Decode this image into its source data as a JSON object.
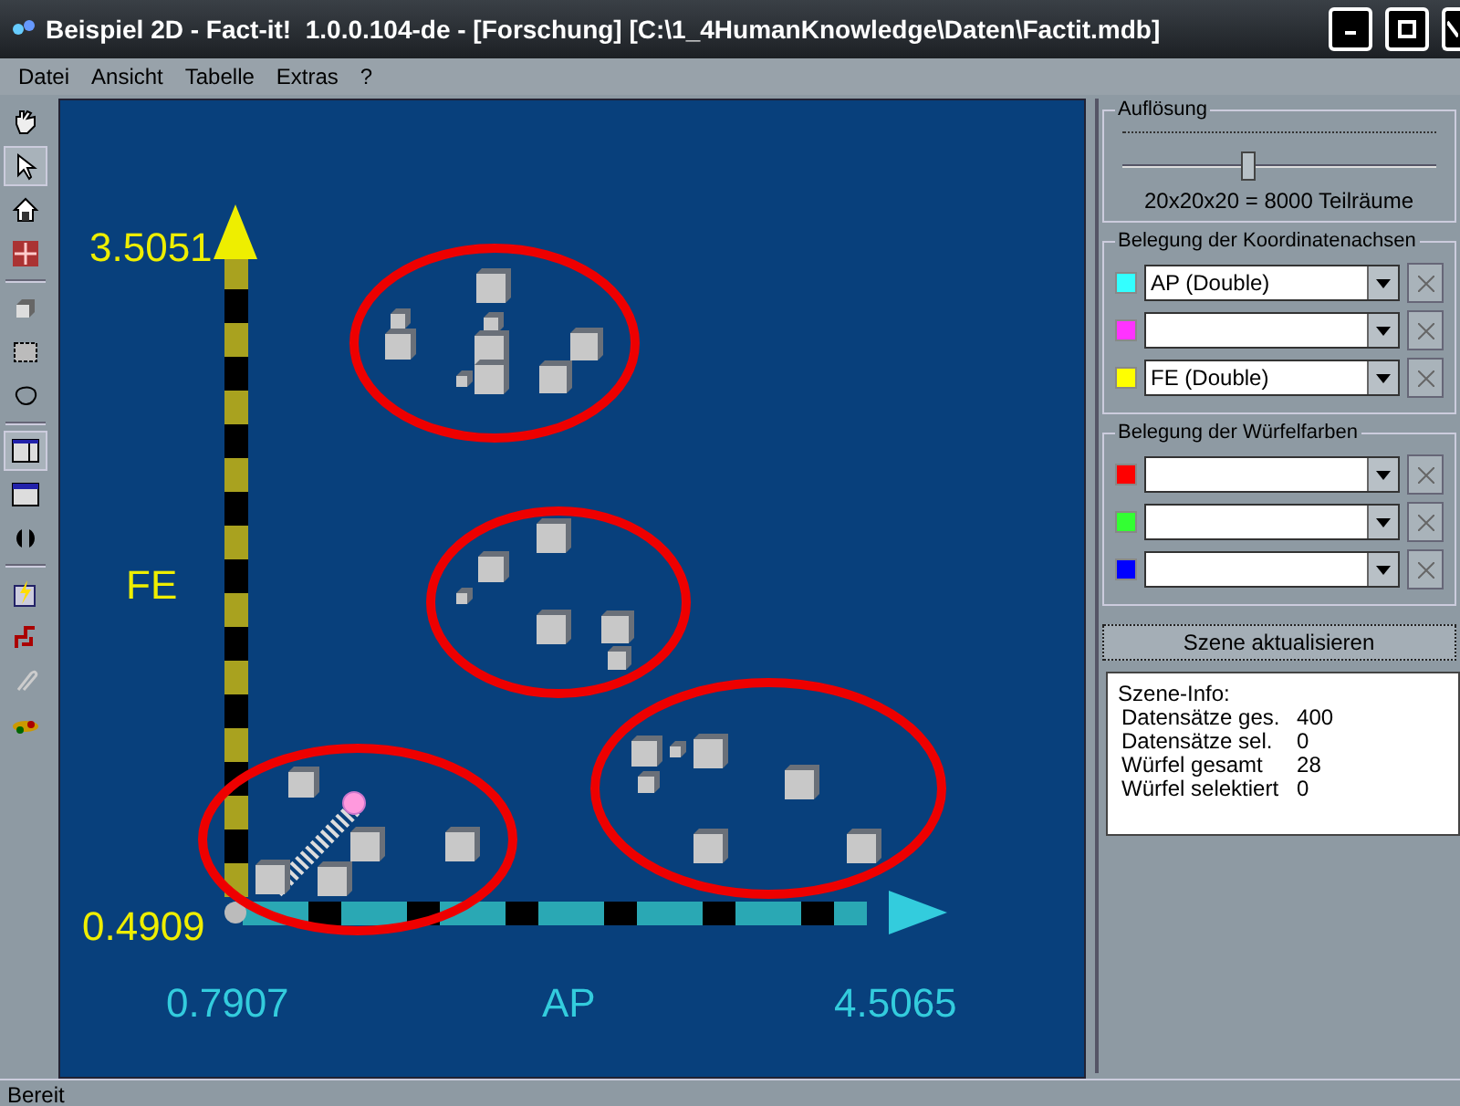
{
  "window": {
    "title": "Beispiel 2D - Fact-it!  1.0.0.104-de - [Forschung] [C:\\1_4HumanKnowledge\\Daten\\Factit.mdb]"
  },
  "menu": [
    "Datei",
    "Ansicht",
    "Tabelle",
    "Extras",
    "?"
  ],
  "tools": [
    {
      "kind": "hand",
      "selected": false
    },
    {
      "kind": "pointer",
      "selected": true
    },
    {
      "kind": "home",
      "selected": false
    },
    {
      "kind": "move",
      "selected": false
    },
    {
      "kind": "sep"
    },
    {
      "kind": "cube",
      "selected": false
    },
    {
      "kind": "rect",
      "selected": false
    },
    {
      "kind": "lasso",
      "selected": false
    },
    {
      "kind": "sep"
    },
    {
      "kind": "layout",
      "selected": true
    },
    {
      "kind": "window",
      "selected": false
    },
    {
      "kind": "split",
      "selected": false
    },
    {
      "kind": "sep"
    },
    {
      "kind": "flash",
      "selected": false
    },
    {
      "kind": "link",
      "selected": false
    },
    {
      "kind": "clip",
      "selected": false
    },
    {
      "kind": "car",
      "selected": false
    }
  ],
  "scene": {
    "y_axis": {
      "label": "FE",
      "max": "3.5051",
      "min": "0.4909"
    },
    "x_axis": {
      "label": "AP",
      "min": "0.7907",
      "max": "4.5065"
    }
  },
  "resolution": {
    "title": "Auflösung",
    "level": 0.4,
    "reading": "20x20x20 = 8000 Teilräume"
  },
  "axes_group": {
    "title": "Belegung der Koordinatenachsen",
    "rows": [
      {
        "color": "#33ffff",
        "value": "AP  (Double)"
      },
      {
        "color": "#ff33ff",
        "value": ""
      },
      {
        "color": "#ffff00",
        "value": "FE  (Double)"
      }
    ]
  },
  "colors_group": {
    "title": "Belegung der Würfelfarben",
    "rows": [
      {
        "color": "#ff0000",
        "value": ""
      },
      {
        "color": "#33ff33",
        "value": ""
      },
      {
        "color": "#0000ff",
        "value": ""
      }
    ]
  },
  "update_button": "Szene aktualisieren",
  "info": {
    "title": "Szene-Info:",
    "rows": [
      {
        "label": "Datensätze ges.",
        "value": "400"
      },
      {
        "label": "Datensätze sel.",
        "value": "0"
      },
      {
        "label": "Würfel gesamt",
        "value": "28"
      },
      {
        "label": "Würfel selektiert",
        "value": "0"
      }
    ]
  },
  "status_bar": "Bereit"
}
